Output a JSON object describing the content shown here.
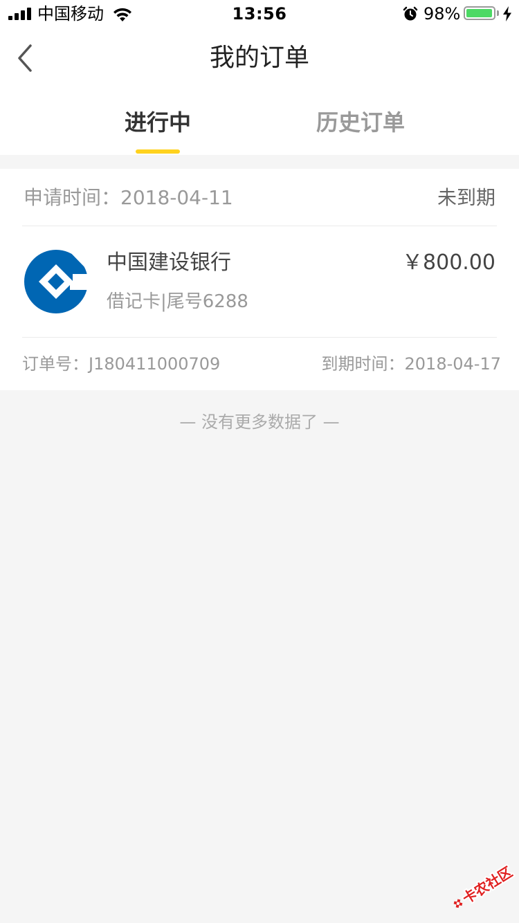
{
  "status_bar": {
    "carrier": "中国移动",
    "time": "13:56",
    "battery_percent": "98%",
    "battery_level": 0.98
  },
  "nav": {
    "title": "我的订单",
    "back_icon": "chevron-left-icon"
  },
  "tabs": {
    "active": "进行中",
    "history": "历史订单"
  },
  "order": {
    "apply_time": "申请时间：2018-04-11",
    "status": "未到期",
    "bank_name": "中国建设银行",
    "card_info": "借记卡|尾号6288",
    "amount": "￥800.00",
    "order_no": "订单号：J180411000709",
    "due_time": "到期时间：2018-04-17"
  },
  "footer": {
    "no_more": "—  没有更多数据了  —"
  },
  "watermark": {
    "text": "卡农社区"
  },
  "colors": {
    "accent": "#ffd21e",
    "bank_blue": "#0066b3",
    "background": "#f5f5f5"
  }
}
